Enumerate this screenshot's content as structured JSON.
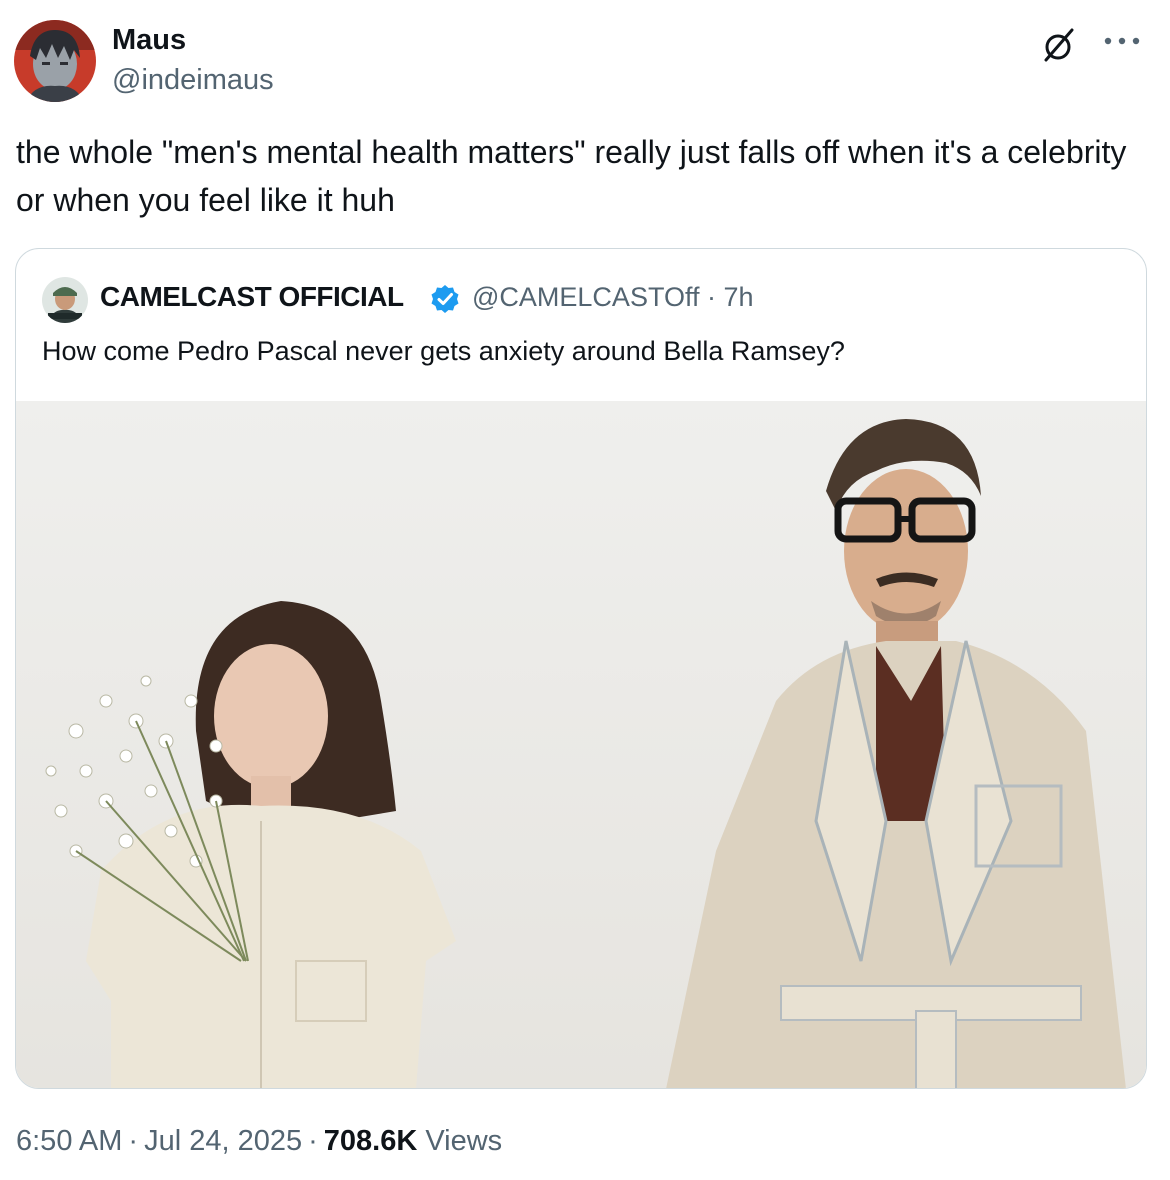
{
  "tweet": {
    "author": {
      "name": "Maus",
      "handle": "@indeimaus",
      "avatar_icon": "profile-avatar"
    },
    "text": "the whole \"men's mental health matters\" really just falls off when it's a celebrity or when you feel like it huh",
    "actions": {
      "grok_icon": "grok-icon",
      "more_icon": "more-icon"
    },
    "quote": {
      "author": {
        "name": "CAMELCAST OFFICIAL",
        "handle": "@CAMELCASTOff",
        "separator": "·",
        "time": "7h",
        "verified_icon": "verified-badge-icon",
        "verified_color": "#1d9bf0"
      },
      "text": "How come Pedro Pascal never gets anxiety around Bella Ramsey?",
      "media_icon": "photo"
    },
    "footer": {
      "time": "6:50 AM",
      "sep1": "·",
      "date": "Jul 24, 2025",
      "sep2": "·",
      "views_count": "708.6K",
      "views_label": "Views"
    }
  },
  "colors": {
    "text": "#0f1419",
    "secondary": "#536471",
    "border": "#cfd9de",
    "accent": "#1d9bf0"
  }
}
